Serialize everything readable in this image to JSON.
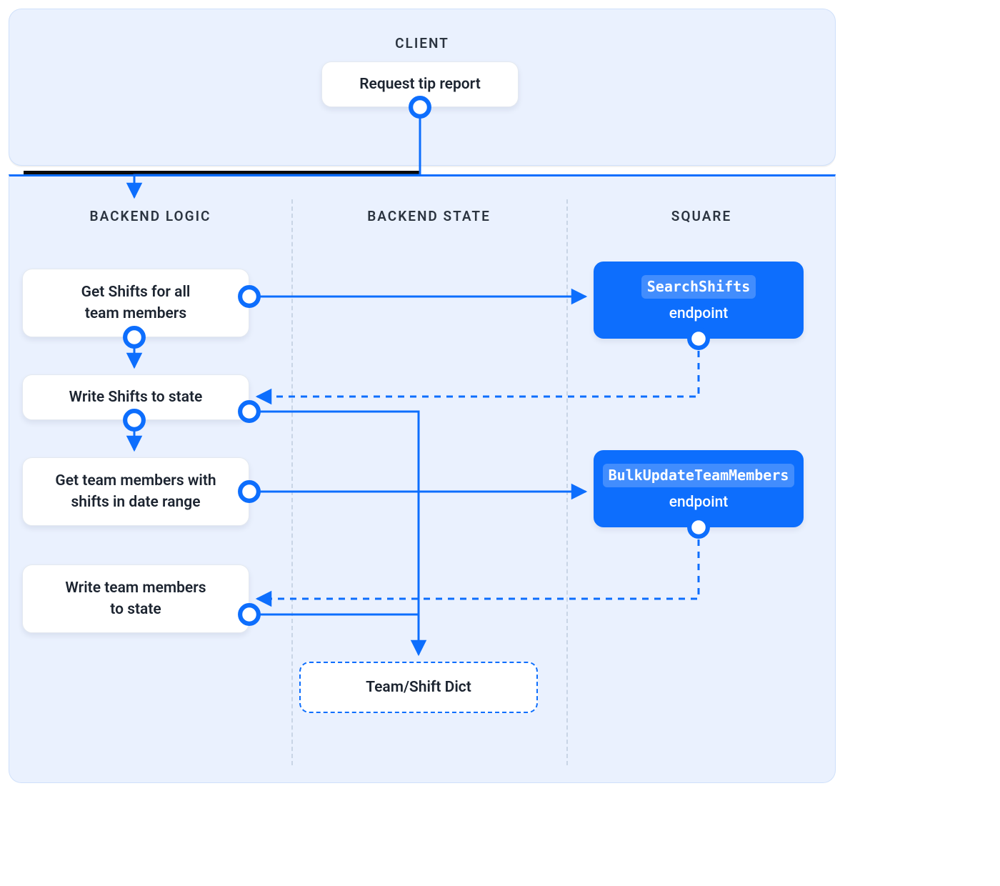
{
  "sections": {
    "client": "CLIENT",
    "backend_logic": "BACKEND LOGIC",
    "backend_state": "BACKEND STATE",
    "square": "SQUARE"
  },
  "nodes": {
    "request": "Request tip report",
    "get_shifts_line1": "Get Shifts for all",
    "get_shifts_line2": "team members",
    "write_shifts": "Write Shifts to state",
    "get_team_line1": "Get team members with",
    "get_team_line2": "shifts in date range",
    "write_team_line1": "Write team members",
    "write_team_line2": "to state",
    "team_shift_dict": "Team/Shift Dict",
    "search_shifts_code": "SearchShifts",
    "search_shifts_label": "endpoint",
    "bulk_update_code": "BulkUpdateTeamMembers",
    "bulk_update_label": "endpoint"
  },
  "colors": {
    "accent": "#0d6efd",
    "panel_bg": "#eaf1fe"
  }
}
